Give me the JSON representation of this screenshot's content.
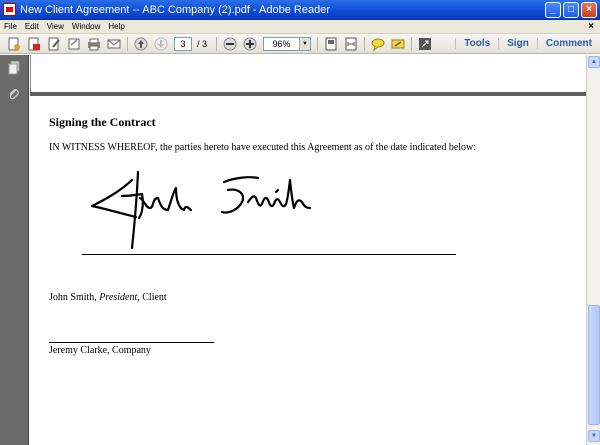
{
  "window": {
    "title": "New Client Agreement -- ABC Company (2).pdf - Adobe Reader",
    "minimize_label": "_",
    "maximize_label": "□",
    "close_label": "×"
  },
  "menu": {
    "items": [
      "File",
      "Edit",
      "View",
      "Window",
      "Help"
    ],
    "doc_close": "×"
  },
  "toolbar": {
    "current_page": "3",
    "page_total": "/ 3",
    "zoom": "96%",
    "tools_label": "Tools",
    "sign_label": "Sign",
    "comment_label": "Comment"
  },
  "document": {
    "heading": "Signing the Contract",
    "paragraph": "IN WITNESS WHEREOF, the parties hereto have executed this Agreement as of the date indicated below:",
    "signer1_name": "John Smith, ",
    "signer1_title": "President,",
    "signer1_role": " Client",
    "signer2": "Jeremy Clarke, Company"
  },
  "colors": {
    "titlebar": "#0b4ad6",
    "link": "#2c5ea8",
    "doc_background": "#5f5f5f"
  }
}
